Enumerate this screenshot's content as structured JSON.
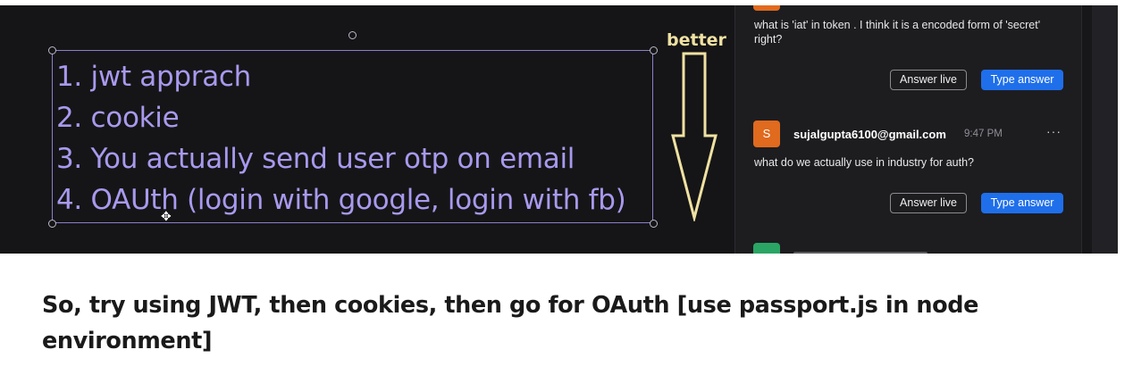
{
  "whiteboard": {
    "items": [
      "1. jwt apprach",
      "2. cookie",
      "3. You actually send user otp on email",
      "4. OAUth (login with google, login with fb)"
    ],
    "annotation": "better",
    "text_color": "#a999ee",
    "annotation_color": "#efe1a2"
  },
  "chat": {
    "messages": [
      {
        "text": "what is 'iat' in token . I think it is a encoded form of 'secret' right?",
        "answer_live_label": "Answer live",
        "type_answer_label": "Type answer"
      },
      {
        "avatar_initial": "S",
        "avatar_color": "#e06a1e",
        "sender": "sujalgupta6100@gmail.com",
        "time": "9:47 PM",
        "more_label": "···",
        "text": "what do we actually use in industry for auth?",
        "answer_live_label": "Answer live",
        "type_answer_label": "Type answer"
      }
    ],
    "peek_avatar_color": "#2aa564",
    "accent_color": "#1f6feb"
  },
  "caption": "So, try using JWT, then cookies, then go for OAuth [use passport.js in node environment]"
}
